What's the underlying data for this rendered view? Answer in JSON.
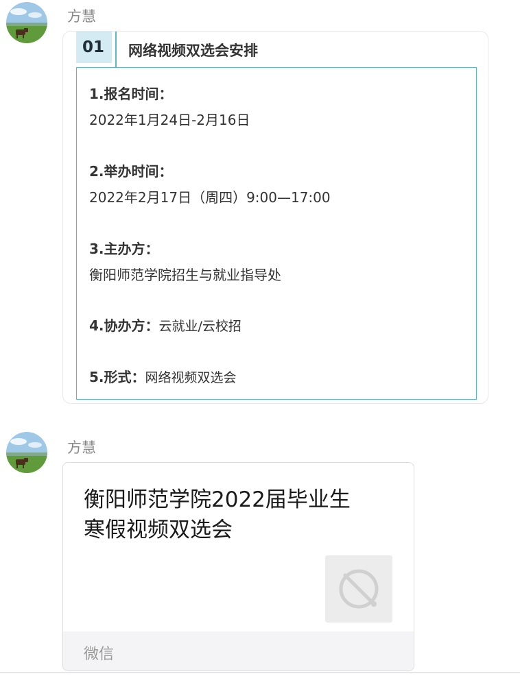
{
  "messages": [
    {
      "sender": "方慧",
      "avatar_icon": "landscape-cow-avatar",
      "article": {
        "section_number": "01",
        "section_title": "网络视频双选会安排",
        "accent_color": "#5bb7c9",
        "number_bg_color": "#d4ebf3",
        "items": [
          {
            "label": "1.报名时间：",
            "value": "2022年1月24日-2月16日"
          },
          {
            "label": "2.举办时间：",
            "value": "2022年2月17日（周四）9:00—17:00"
          },
          {
            "label": "3.主办方：",
            "value": "衡阳师范学院招生与就业指导处"
          },
          {
            "label": "4.协办方：",
            "value": "云就业/云校招"
          },
          {
            "label": "5.形式：",
            "value": "网络视频双选会"
          }
        ]
      }
    },
    {
      "sender": "方慧",
      "avatar_icon": "landscape-cow-avatar",
      "link_card": {
        "title_line1": "衡阳师范学院2022届毕业生",
        "title_line2": "寒假视频双选会",
        "thumb_icon": "broken-link-planet-icon",
        "source": "微信"
      }
    }
  ]
}
